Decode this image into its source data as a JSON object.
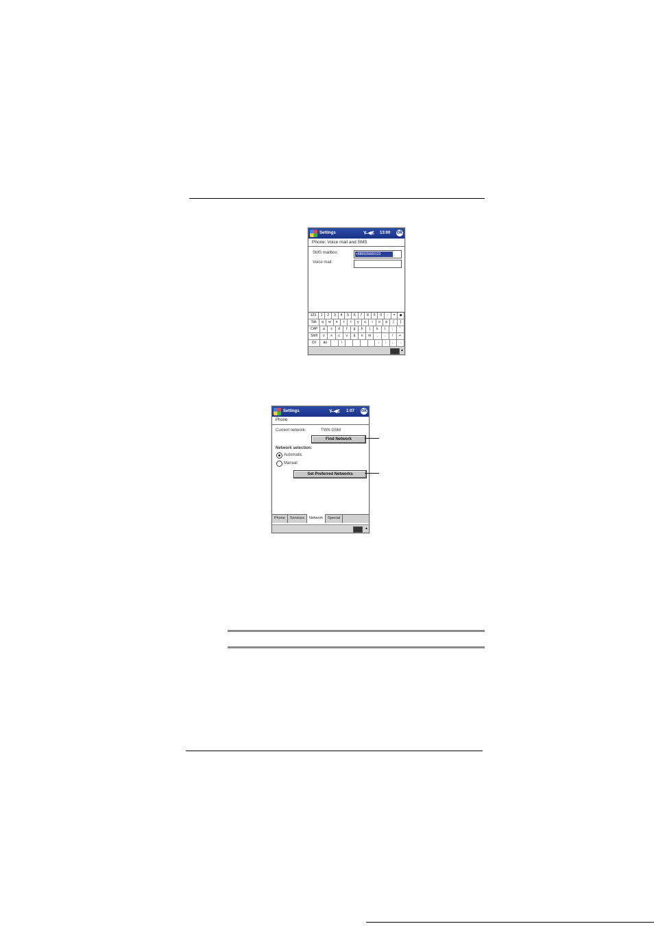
{
  "screen1": {
    "title": "Settings",
    "status_icons": "Y̶ ◀€",
    "time": "13:00",
    "ok": "ok",
    "header": "Phone: Voice mail and SMS",
    "sms_label": "SMS mailbox:",
    "sms_value": "+886935000123",
    "voicemail_label": "Voice mail:",
    "voicemail_value": "",
    "keyboard": [
      [
        "123",
        "1",
        "2",
        "3",
        "4",
        "5",
        "6",
        "7",
        "8",
        "9",
        "0",
        "-",
        "=",
        "◆"
      ],
      [
        "Tab",
        "q",
        "w",
        "e",
        "r",
        "t",
        "y",
        "u",
        "i",
        "o",
        "p",
        "[",
        "]"
      ],
      [
        "CAP",
        "a",
        "s",
        "d",
        "f",
        "g",
        "h",
        "j",
        "k",
        "l",
        ";",
        "'"
      ],
      [
        "Shift",
        "z",
        "x",
        "c",
        "v",
        "b",
        "n",
        "m",
        ",",
        ".",
        "/",
        "↵"
      ],
      [
        "Ctl",
        "áü",
        "`",
        "\\",
        "",
        "",
        "",
        "",
        "↓",
        "↑",
        "←",
        "→"
      ]
    ]
  },
  "screen2": {
    "title": "Settings",
    "status_icons": "Y̶ ◀€",
    "time": "1:07",
    "ok": "ok",
    "header": "Phone",
    "current_network_label": "Current network:",
    "current_network_value": "TWN GSM",
    "find_network": "Find Network",
    "selection_label": "Network selection:",
    "automatic": "Automatic",
    "manual": "Manual",
    "set_preferred": "Set Preferred Networks",
    "tabs": [
      "Phone",
      "Services",
      "Network",
      "Special"
    ],
    "active_tab": "Network"
  }
}
